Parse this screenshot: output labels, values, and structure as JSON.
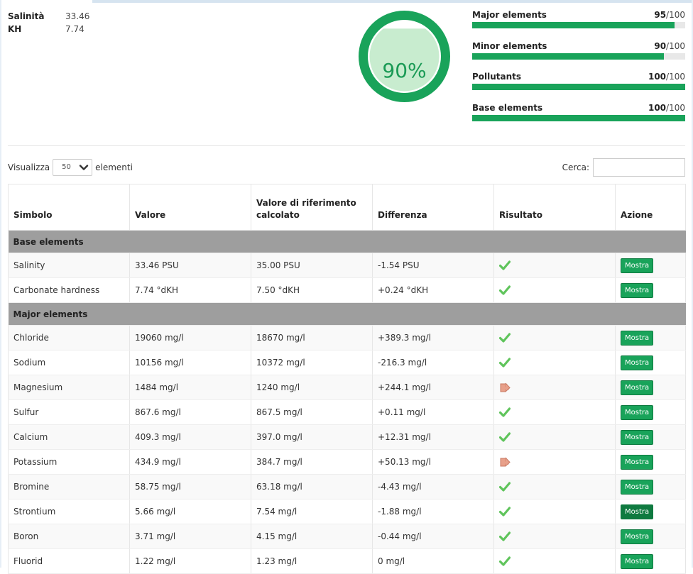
{
  "params": [
    {
      "name": "Salinità",
      "value": "33.46"
    },
    {
      "name": "KH",
      "value": "7.74"
    }
  ],
  "gauge": {
    "percent": 90,
    "label": "90%",
    "color": "#19a35a"
  },
  "scores": [
    {
      "label": "Major elements",
      "score": "95",
      "max": "/100",
      "fill": 95
    },
    {
      "label": "Minor elements",
      "score": "90",
      "max": "/100",
      "fill": 90
    },
    {
      "label": "Pollutants",
      "score": "100",
      "max": "/100",
      "fill": 100
    },
    {
      "label": "Base elements",
      "score": "100",
      "max": "/100",
      "fill": 100
    }
  ],
  "length_menu": {
    "before": "Visualizza",
    "selected": "50",
    "after": "elementi"
  },
  "search": {
    "label": "Cerca:",
    "value": ""
  },
  "table": {
    "headers": [
      "Simbolo",
      "Valore",
      "Valore di riferimento calcolato",
      "Differenza",
      "Risultato",
      "Azione"
    ],
    "action_label": "Mostra",
    "groups": [
      {
        "name": "Base elements",
        "rows": [
          {
            "symbol": "Salinity",
            "value": "33.46 PSU",
            "ref": "35.00 PSU",
            "diff": "-1.54 PSU",
            "result": "check-icon"
          },
          {
            "symbol": "Carbonate hardness",
            "value": "7.74 °dKH",
            "ref": "7.50 °dKH",
            "diff": "+0.24 °dKH",
            "result": "check-icon"
          }
        ]
      },
      {
        "name": "Major elements",
        "rows": [
          {
            "symbol": "Chloride",
            "value": "19060 mg/l",
            "ref": "18670 mg/l",
            "diff": "+389.3 mg/l",
            "result": "check-icon"
          },
          {
            "symbol": "Sodium",
            "value": "10156 mg/l",
            "ref": "10372 mg/l",
            "diff": "-216.3 mg/l",
            "result": "check-icon"
          },
          {
            "symbol": "Magnesium",
            "value": "1484 mg/l",
            "ref": "1240 mg/l",
            "diff": "+244.1 mg/l",
            "result": "arrow-icon"
          },
          {
            "symbol": "Sulfur",
            "value": "867.6 mg/l",
            "ref": "867.5 mg/l",
            "diff": "+0.11 mg/l",
            "result": "check-icon"
          },
          {
            "symbol": "Calcium",
            "value": "409.3 mg/l",
            "ref": "397.0 mg/l",
            "diff": "+12.31 mg/l",
            "result": "check-icon"
          },
          {
            "symbol": "Potassium",
            "value": "434.9 mg/l",
            "ref": "384.7 mg/l",
            "diff": "+50.13 mg/l",
            "result": "arrow-icon"
          },
          {
            "symbol": "Bromine",
            "value": "58.75 mg/l",
            "ref": "63.18 mg/l",
            "diff": "-4.43 mg/l",
            "result": "check-icon"
          },
          {
            "symbol": "Strontium",
            "value": "5.66 mg/l",
            "ref": "7.54 mg/l",
            "diff": "-1.88 mg/l",
            "result": "check-icon",
            "active": true
          },
          {
            "symbol": "Boron",
            "value": "3.71 mg/l",
            "ref": "4.15 mg/l",
            "diff": "-0.44 mg/l",
            "result": "check-icon"
          },
          {
            "symbol": "Fluorid",
            "value": "1.22 mg/l",
            "ref": "1.23 mg/l",
            "diff": "0 mg/l",
            "result": "check-icon"
          }
        ]
      }
    ]
  }
}
